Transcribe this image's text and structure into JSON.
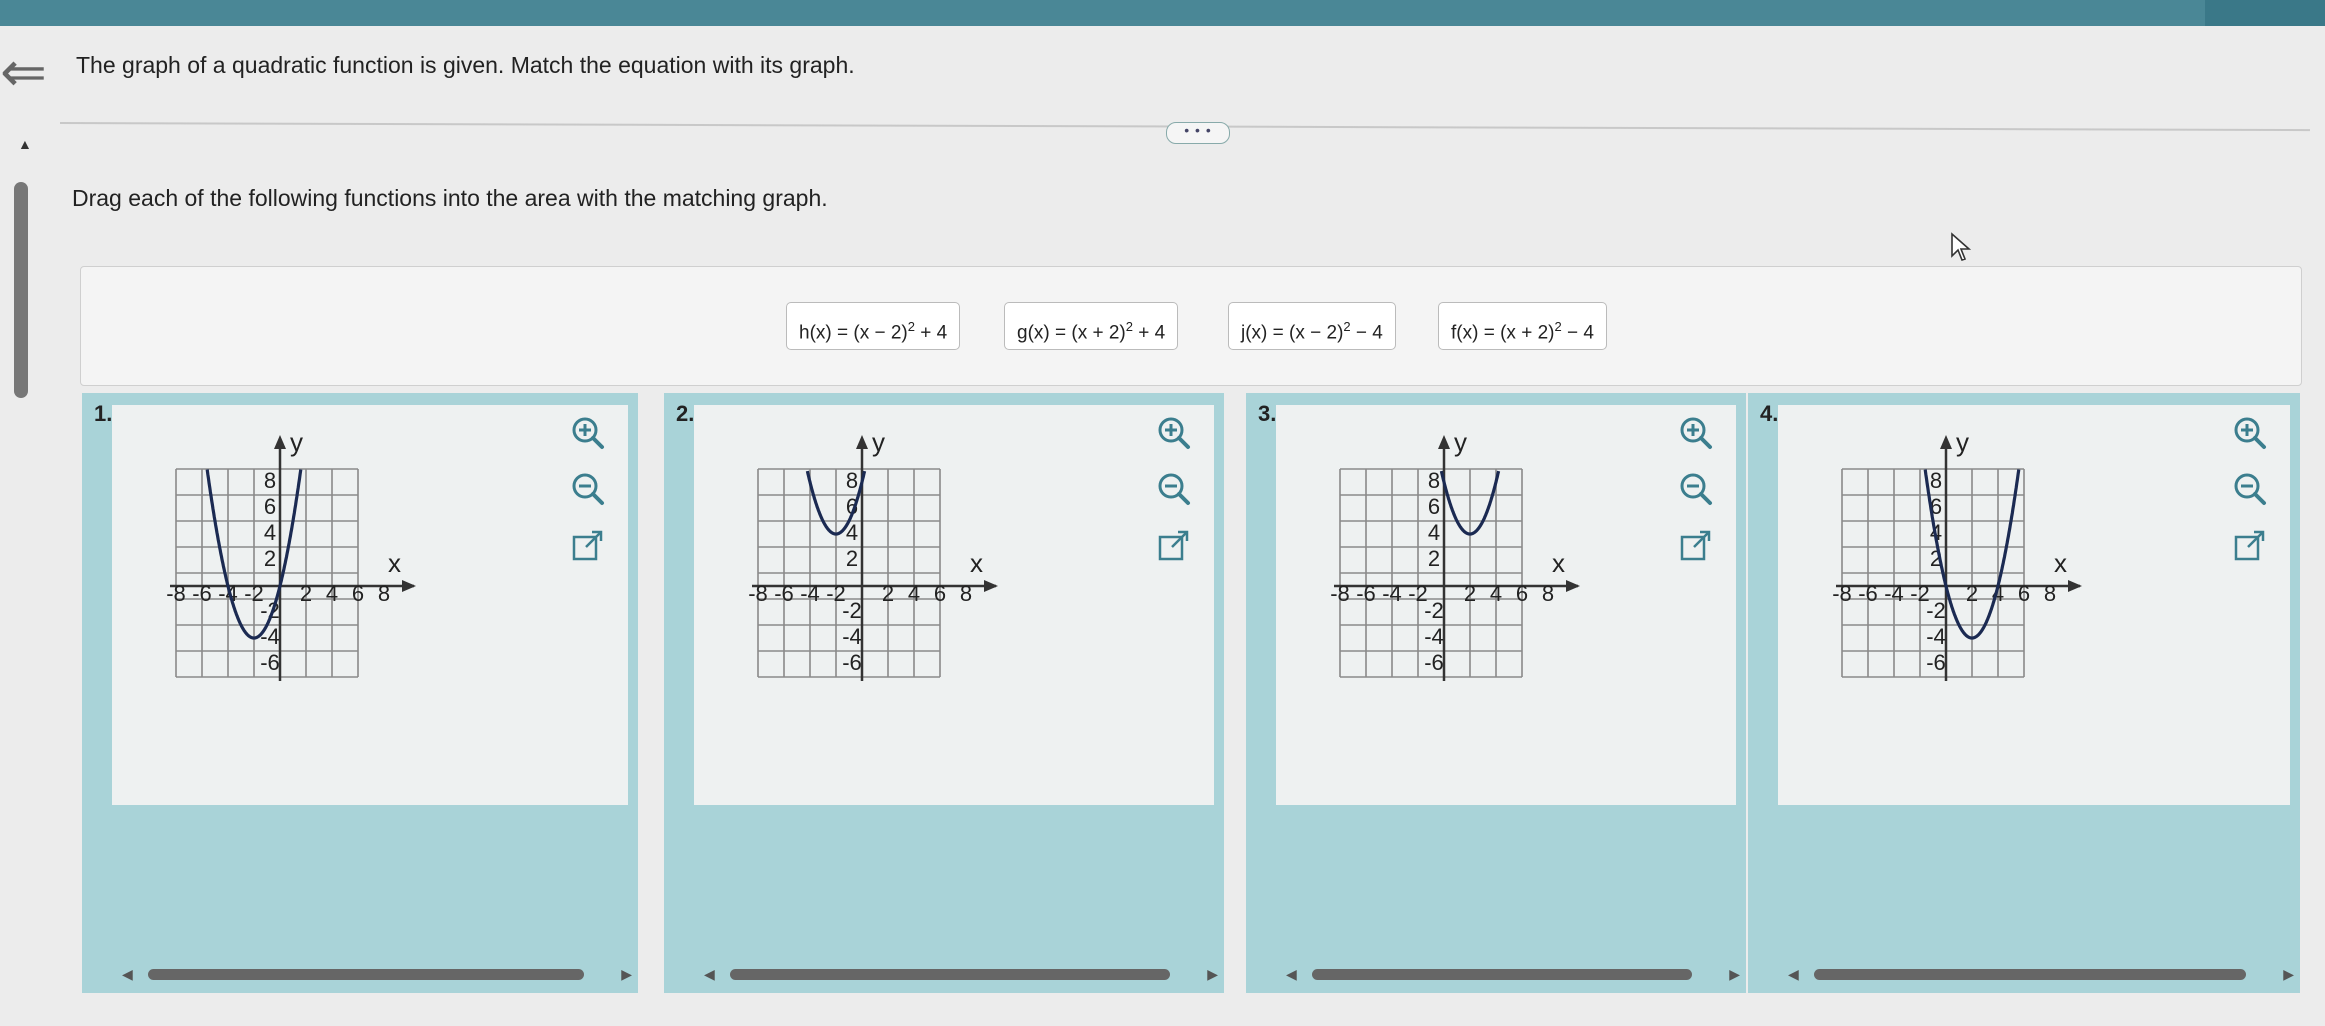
{
  "question": "The graph of a quadratic function is given. Match the equation with its graph.",
  "more_button": "• • •",
  "instruction": "Drag each of the following functions into the area with the matching graph.",
  "functions": [
    {
      "name": "h",
      "pre": "h(x) = (x − 2)",
      "exp": "2",
      "post": " + 4"
    },
    {
      "name": "g",
      "pre": "g(x) = (x + 2)",
      "exp": "2",
      "post": " + 4"
    },
    {
      "name": "j",
      "pre": "j(x) = (x − 2)",
      "exp": "2",
      "post": " − 4"
    },
    {
      "name": "f",
      "pre": "f(x) = (x + 2)",
      "exp": "2",
      "post": " − 4"
    }
  ],
  "panels": [
    {
      "number": "1.",
      "vertex": [
        -2,
        -4
      ]
    },
    {
      "number": "2.",
      "vertex": [
        -2,
        4
      ]
    },
    {
      "number": "3.",
      "vertex": [
        2,
        4
      ]
    },
    {
      "number": "4.",
      "vertex": [
        2,
        -4
      ]
    }
  ],
  "graph_axes": {
    "x_label": "x",
    "y_label": "y",
    "x_ticks": [
      "-8",
      "-6",
      "-4",
      "-2",
      "2",
      "4",
      "6",
      "8"
    ],
    "y_ticks": [
      "8",
      "6",
      "4",
      "2",
      "-2",
      "-4",
      "-6"
    ],
    "x_range": [
      -10,
      10
    ],
    "y_range": [
      -8,
      10
    ]
  },
  "icons": [
    "zoom-in-icon",
    "zoom-out-icon",
    "expand-icon"
  ],
  "colors": {
    "panel": "#a9d3d8",
    "accent": "#3b7e8e",
    "topbar": "#4a8796"
  }
}
